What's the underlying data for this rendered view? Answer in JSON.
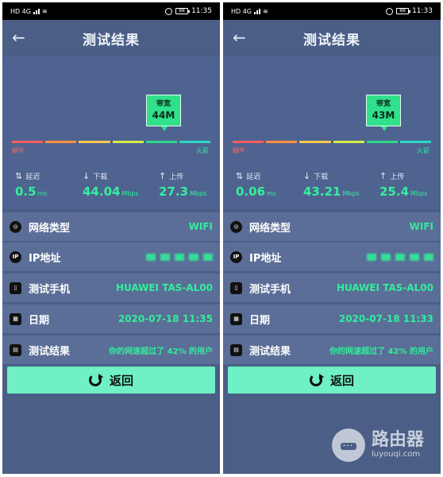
{
  "status_bar": {
    "left_text": "HD 4G",
    "right_text_left": "11:35",
    "right_text_right": "11:33",
    "battery": "88"
  },
  "screens": [
    {
      "title": "测试结果",
      "bandwidth_label": "带宽",
      "bandwidth_value": "44M",
      "scale_low": "蜗牛",
      "scale_high": "火箭",
      "metrics": [
        {
          "label": "延迟",
          "value": "0.5",
          "unit": "ms",
          "icon": "latency-icon"
        },
        {
          "label": "下载",
          "value": "44.04",
          "unit": "Mbps",
          "icon": "download-icon"
        },
        {
          "label": "上传",
          "value": "27.3",
          "unit": "Mbps",
          "icon": "upload-icon"
        }
      ],
      "rows": [
        {
          "label": "网络类型",
          "value": "WIFI",
          "icon": "globe-icon"
        },
        {
          "label": "IP地址",
          "value": "",
          "icon": "ip-icon"
        },
        {
          "label": "测试手机",
          "value": "HUAWEI TAS-AL00",
          "icon": "phone-icon"
        },
        {
          "label": "日期",
          "value": "2020-07-18 11:35",
          "icon": "calendar-icon"
        },
        {
          "label": "测试结果",
          "value": "你的网速超过了 42% 的用户",
          "icon": "report-icon"
        }
      ],
      "button_label": "返回"
    },
    {
      "title": "测试结果",
      "bandwidth_label": "带宽",
      "bandwidth_value": "43M",
      "scale_low": "蜗牛",
      "scale_high": "火箭",
      "metrics": [
        {
          "label": "延迟",
          "value": "0.06",
          "unit": "ms",
          "icon": "latency-icon"
        },
        {
          "label": "下载",
          "value": "43.21",
          "unit": "Mbps",
          "icon": "download-icon"
        },
        {
          "label": "上传",
          "value": "25.4",
          "unit": "Mbps",
          "icon": "upload-icon"
        }
      ],
      "rows": [
        {
          "label": "网络类型",
          "value": "WIFI",
          "icon": "globe-icon"
        },
        {
          "label": "IP地址",
          "value": "",
          "icon": "ip-icon"
        },
        {
          "label": "测试手机",
          "value": "HUAWEI TAS-AL00",
          "icon": "phone-icon"
        },
        {
          "label": "日期",
          "value": "2020-07-18 11:33",
          "icon": "calendar-icon"
        },
        {
          "label": "测试结果",
          "value": "你的网速超过了 42% 的用户",
          "icon": "report-icon"
        }
      ],
      "button_label": "返回"
    }
  ],
  "watermark": {
    "title": "路由器",
    "url": "luyouqi.com"
  },
  "colors": {
    "panel": "#4a5e86",
    "row": "#5a6e97",
    "accent": "#32ee9b",
    "button": "#6ff0c5",
    "scale": [
      "#ff5c5c",
      "#ff8f3f",
      "#f6c84c",
      "#d7eb48",
      "#30d98d",
      "#2ad6c6"
    ]
  }
}
